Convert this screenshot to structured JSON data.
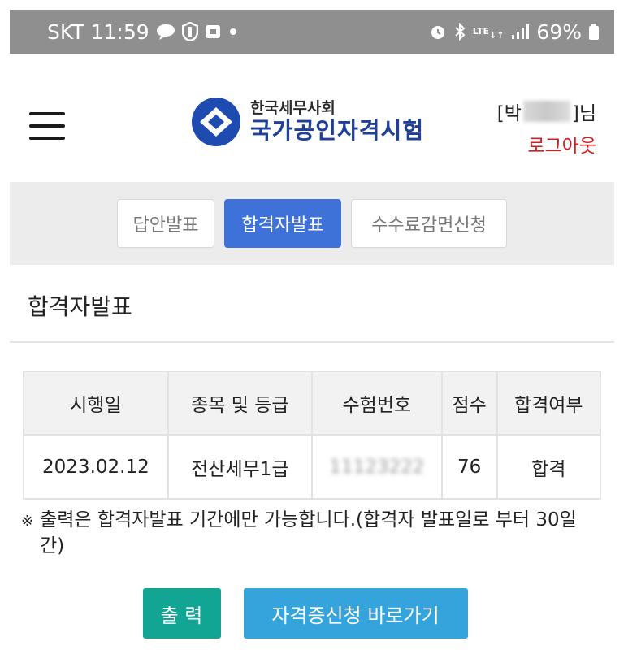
{
  "status_bar": {
    "carrier": "SKT",
    "time": "11:59",
    "lte": "LTE",
    "battery": "69%",
    "icons": [
      "message-icon",
      "vpn-icon",
      "notification-icon",
      "dot-icon",
      "alarm-icon",
      "bluetooth-icon",
      "lte-icon",
      "signal-icon",
      "battery-icon"
    ]
  },
  "header": {
    "logo_sub": "한국세무사회",
    "logo_main": "국가공인자격시험",
    "user_prefix": "[박",
    "user_suffix": "]님",
    "logout": "로그아웃",
    "brand_color": "#1e3f9a"
  },
  "tabs": [
    {
      "label": "답안발표",
      "active": false
    },
    {
      "label": "합격자발표",
      "active": true
    },
    {
      "label": "수수료감면신청",
      "active": false
    }
  ],
  "page_title": "합격자발표",
  "table": {
    "headers": [
      "시행일",
      "종목 및 등급",
      "수험번호",
      "점수",
      "합격여부"
    ],
    "row": {
      "date": "2023.02.12",
      "subject": "전산세무1급",
      "exam_no": "11123222",
      "score": "76",
      "result": "합격"
    }
  },
  "notice": {
    "mark": "※",
    "text": "출력은 합격자발표 기간에만 가능합니다.(합격자 발표일로 부터 30일간)"
  },
  "buttons": {
    "print": "출 력",
    "cert": "자격증신청 바로가기",
    "print_color": "#12a594",
    "cert_color": "#36a4dc"
  }
}
